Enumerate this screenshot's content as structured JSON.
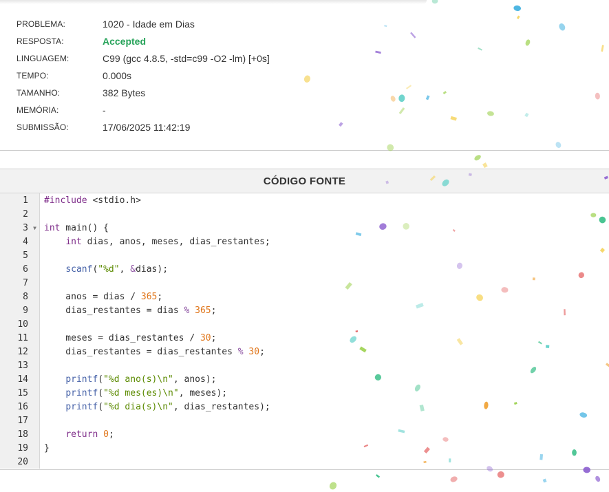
{
  "submission": {
    "problem_label": "PROBLEMA:",
    "problem_value": "1020 - Idade em Dias",
    "response_label": "RESPOSTA:",
    "response_value": "Accepted",
    "language_label": "LINGUAGEM:",
    "language_value": "C99 (gcc 4.8.5, -std=c99 -O2 -lm) [+0s]",
    "time_label": "TEMPO:",
    "time_value": "0.000s",
    "size_label": "TAMANHO:",
    "size_value": "382 Bytes",
    "memory_label": "MEMÓRIA:",
    "memory_value": "-",
    "submitted_label": "SUBMISSÃO:",
    "submitted_value": "17/06/2025 11:42:19"
  },
  "code_panel": {
    "title": "CÓDIGO FONTE",
    "line_numbers": [
      "1",
      "2",
      "3",
      "4",
      "5",
      "6",
      "7",
      "8",
      "9",
      "10",
      "11",
      "12",
      "13",
      "14",
      "15",
      "16",
      "17",
      "18",
      "19",
      "20"
    ],
    "lines": [
      "#include <stdio.h>",
      "",
      "int main() {",
      "    int dias, anos, meses, dias_restantes;",
      "",
      "    scanf(\"%d\", &dias);",
      "",
      "    anos = dias / 365;",
      "    dias_restantes = dias % 365;",
      "",
      "    meses = dias_restantes / 30;",
      "    dias_restantes = dias_restantes % 30;",
      "",
      "    printf(\"%d ano(s)\\n\", anos);",
      "    printf(\"%d mes(es)\\n\", meses);",
      "    printf(\"%d dia(s)\\n\", dias_restantes);",
      "",
      "    return 0;",
      "}",
      ""
    ]
  },
  "colors": {
    "accepted": "#27a35a",
    "keyword": "#7f2e8a",
    "function": "#4662a8",
    "string": "#5b8a00",
    "number": "#e0761b"
  },
  "icons": {
    "fold_marker": "fold-arrow-icon"
  }
}
